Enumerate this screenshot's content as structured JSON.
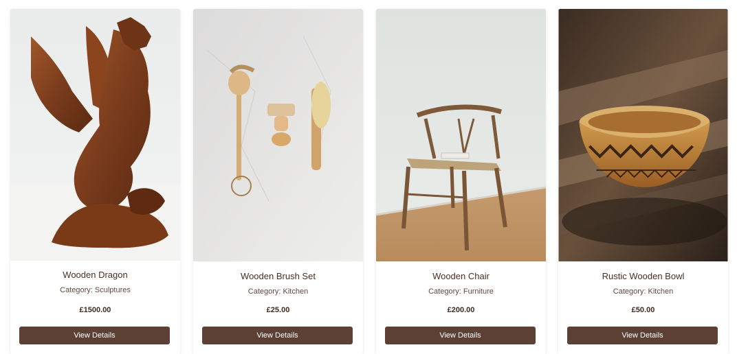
{
  "products": [
    {
      "name": "Wooden Dragon",
      "category": "Category: Sculptures",
      "price": "£1500.00",
      "button": "View Details"
    },
    {
      "name": "Wooden Brush Set",
      "category": "Category: Kitchen",
      "price": "£25.00",
      "button": "View Details"
    },
    {
      "name": "Wooden Chair",
      "category": "Category: Furniture",
      "price": "£200.00",
      "button": "View Details"
    },
    {
      "name": "Rustic Wooden Bowl",
      "category": "Category: Kitchen",
      "price": "£50.00",
      "button": "View Details"
    }
  ],
  "colors": {
    "button": "#5d4034",
    "title": "#4a2f22"
  }
}
